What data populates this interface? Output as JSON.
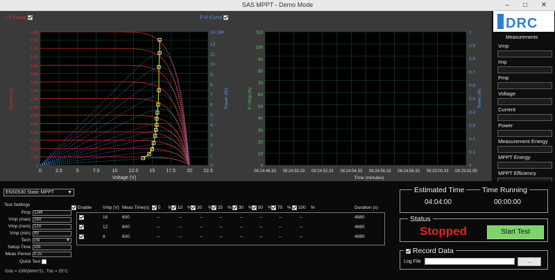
{
  "window": {
    "title": "SAS MPPT - Demo Mode"
  },
  "iv_chart": {
    "iv_curve_label": "I-V Curve",
    "pv_curve_label": "P-V Curve",
    "xlabel": "Voltage (V)",
    "ylabel_left": "Current (A)",
    "ylabel_right": "Power (W)",
    "x_ticks": [
      "0",
      "2.5",
      "5",
      "7.5",
      "10",
      "12.5",
      "15",
      "17.5",
      "20",
      "22.5"
    ],
    "y_left_ticks": [
      "0.80",
      "0.75",
      "0.70",
      "0.65",
      "0.60",
      "0.55",
      "0.50",
      "0.45",
      "0.40",
      "0.35",
      "0.30",
      "0.25",
      "0.20",
      "0.15",
      "0.10",
      "0.05",
      "0"
    ],
    "y_right_ticks": [
      "13.188",
      "12",
      "11",
      "10",
      "9",
      "8",
      "7",
      "6",
      "5",
      "4",
      "3",
      "2",
      "1",
      "0"
    ]
  },
  "chart_data": [
    {
      "type": "line",
      "title": "",
      "xlabel": "Voltage (V)",
      "ylabel": "Current (A)",
      "y2label": "Power (W)",
      "xlim": [
        0,
        22.5
      ],
      "ylim": [
        0,
        0.8
      ],
      "y2lim": [
        0,
        13.188
      ],
      "curves": {
        "voc": 20,
        "vmp": 16,
        "isc_levels": [
          0.8,
          0.7,
          0.6,
          0.5,
          0.4,
          0.3,
          0.25,
          0.2,
          0.15,
          0.1,
          0.05
        ],
        "mppt_track_power": [
          0.7,
          1.1,
          1.6,
          2.2,
          2.9,
          3.5,
          4.0,
          4.6,
          5.2,
          6.0,
          7.4,
          9.7,
          11.1,
          12.4
        ]
      }
    },
    {
      "type": "line",
      "title": "",
      "xlabel": "Time (minutes)",
      "ylabel": "P / Pmp (%)",
      "y2label": "Power (W)",
      "ylim": [
        0,
        113
      ],
      "y2lim": [
        0,
        1
      ],
      "x_ticks": [
        "08:24:48.33",
        "08:24:50.33",
        "08:24:52.33",
        "08:24:54.33",
        "08:24:56.33",
        "08:24:58.33",
        "08:25:00.33",
        "08:25:02.95"
      ],
      "y_ticks": [
        "113",
        "100",
        "90",
        "80",
        "70",
        "60",
        "50",
        "40",
        "30",
        "20",
        "10",
        "0"
      ],
      "y2_ticks": [
        "1",
        "0.9",
        "0.8",
        "0.7",
        "0.6",
        "0.5",
        "0.4",
        "0.3",
        "0.2",
        "0.1",
        "0"
      ],
      "series": []
    }
  ],
  "measurements": {
    "logo": "iDRC",
    "title": "Measurements",
    "items": [
      "Vmp",
      "Imp",
      "Pmp",
      "Voltage",
      "Current",
      "Power",
      "Measurement Energy",
      "MPPT Energy",
      "MPPT Efficiency"
    ]
  },
  "test": {
    "standard": "EN50530 Static MPPT",
    "settings_title": "Test Settings",
    "fields": [
      {
        "k": "Pmp",
        "v": "12W"
      },
      {
        "k": "Vmp (max)",
        "v": "16V"
      },
      {
        "k": "Vmp (nom)",
        "v": "12V"
      },
      {
        "k": "Vmp (min)",
        "v": "8V"
      },
      {
        "k": "Tech",
        "v": "cSi"
      },
      {
        "k": "Setup Time",
        "v": "10s"
      },
      {
        "k": "Meas Period",
        "v": "0.2s"
      }
    ],
    "quick_test": "Quick Test",
    "footer": "Gstc = 1000(W/m^2) , Tstc = 25°C"
  },
  "table": {
    "headers": [
      "Enable",
      "Vmp (V)",
      "Meas Time(s)",
      "5",
      "%",
      "10",
      "%",
      "20",
      "%",
      "25",
      "%",
      "30",
      "%",
      "50",
      "%",
      "75",
      "%",
      "100",
      "%",
      "Duration (s)"
    ],
    "rows": [
      {
        "vmp": "16",
        "meas": "600",
        "dur": "4880"
      },
      {
        "vmp": "12",
        "meas": "600",
        "dur": "4880"
      },
      {
        "vmp": "8",
        "meas": "600",
        "dur": "4880"
      }
    ],
    "dash": "--"
  },
  "timing": {
    "est_title": "Estimated Time",
    "est_value": "04:04:00",
    "run_title": "Time Running",
    "run_value": "00:00:00"
  },
  "status": {
    "title": "Status",
    "value": "Stopped",
    "button": "Start Test"
  },
  "record": {
    "title": "Record Data",
    "log_label": "Log File",
    "browse": "...",
    "log_value": ""
  }
}
